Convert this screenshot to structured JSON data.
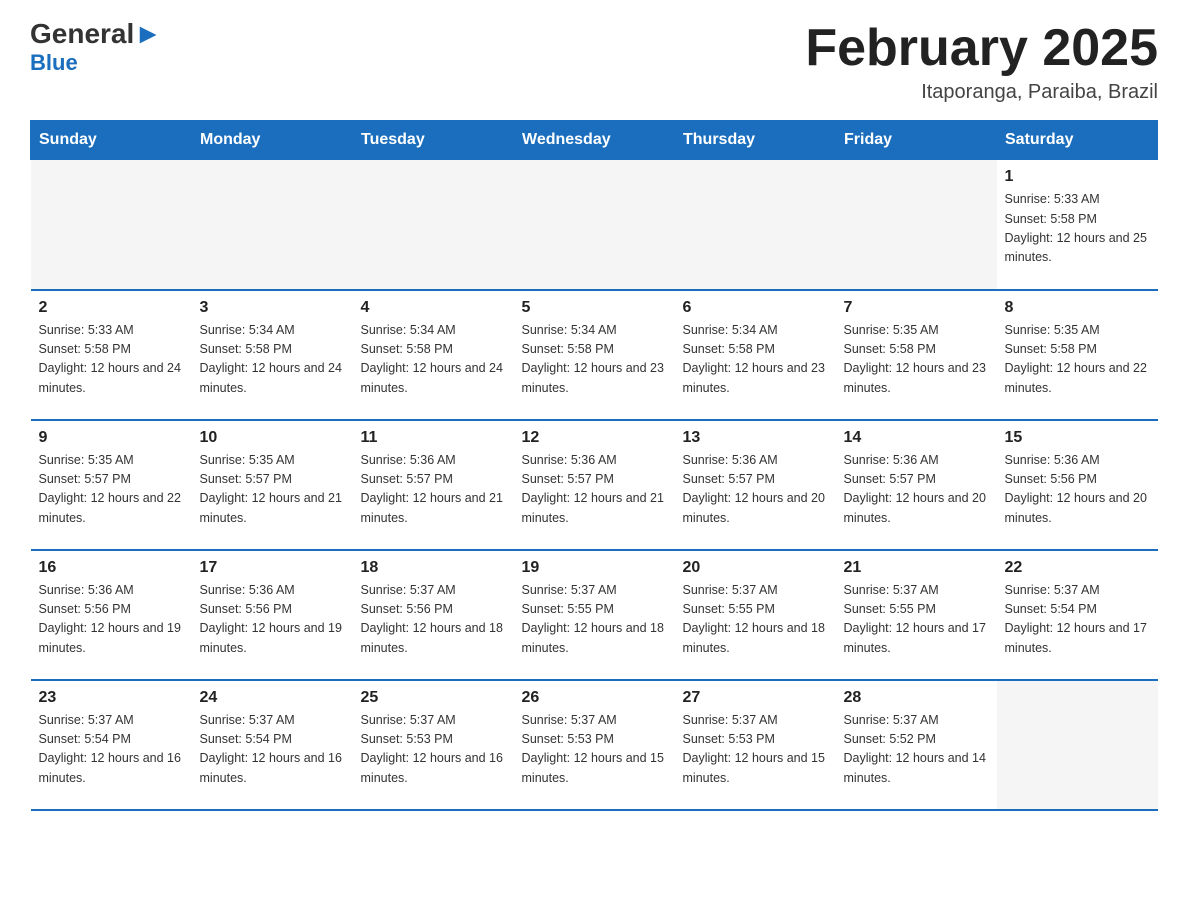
{
  "logo": {
    "text_general": "General",
    "text_arrow": "▶",
    "text_blue": "Blue"
  },
  "title": "February 2025",
  "location": "Itaporanga, Paraiba, Brazil",
  "weekdays": [
    "Sunday",
    "Monday",
    "Tuesday",
    "Wednesday",
    "Thursday",
    "Friday",
    "Saturday"
  ],
  "weeks": [
    [
      {
        "day": "",
        "info": ""
      },
      {
        "day": "",
        "info": ""
      },
      {
        "day": "",
        "info": ""
      },
      {
        "day": "",
        "info": ""
      },
      {
        "day": "",
        "info": ""
      },
      {
        "day": "",
        "info": ""
      },
      {
        "day": "1",
        "info": "Sunrise: 5:33 AM\nSunset: 5:58 PM\nDaylight: 12 hours and 25 minutes."
      }
    ],
    [
      {
        "day": "2",
        "info": "Sunrise: 5:33 AM\nSunset: 5:58 PM\nDaylight: 12 hours and 24 minutes."
      },
      {
        "day": "3",
        "info": "Sunrise: 5:34 AM\nSunset: 5:58 PM\nDaylight: 12 hours and 24 minutes."
      },
      {
        "day": "4",
        "info": "Sunrise: 5:34 AM\nSunset: 5:58 PM\nDaylight: 12 hours and 24 minutes."
      },
      {
        "day": "5",
        "info": "Sunrise: 5:34 AM\nSunset: 5:58 PM\nDaylight: 12 hours and 23 minutes."
      },
      {
        "day": "6",
        "info": "Sunrise: 5:34 AM\nSunset: 5:58 PM\nDaylight: 12 hours and 23 minutes."
      },
      {
        "day": "7",
        "info": "Sunrise: 5:35 AM\nSunset: 5:58 PM\nDaylight: 12 hours and 23 minutes."
      },
      {
        "day": "8",
        "info": "Sunrise: 5:35 AM\nSunset: 5:58 PM\nDaylight: 12 hours and 22 minutes."
      }
    ],
    [
      {
        "day": "9",
        "info": "Sunrise: 5:35 AM\nSunset: 5:57 PM\nDaylight: 12 hours and 22 minutes."
      },
      {
        "day": "10",
        "info": "Sunrise: 5:35 AM\nSunset: 5:57 PM\nDaylight: 12 hours and 21 minutes."
      },
      {
        "day": "11",
        "info": "Sunrise: 5:36 AM\nSunset: 5:57 PM\nDaylight: 12 hours and 21 minutes."
      },
      {
        "day": "12",
        "info": "Sunrise: 5:36 AM\nSunset: 5:57 PM\nDaylight: 12 hours and 21 minutes."
      },
      {
        "day": "13",
        "info": "Sunrise: 5:36 AM\nSunset: 5:57 PM\nDaylight: 12 hours and 20 minutes."
      },
      {
        "day": "14",
        "info": "Sunrise: 5:36 AM\nSunset: 5:57 PM\nDaylight: 12 hours and 20 minutes."
      },
      {
        "day": "15",
        "info": "Sunrise: 5:36 AM\nSunset: 5:56 PM\nDaylight: 12 hours and 20 minutes."
      }
    ],
    [
      {
        "day": "16",
        "info": "Sunrise: 5:36 AM\nSunset: 5:56 PM\nDaylight: 12 hours and 19 minutes."
      },
      {
        "day": "17",
        "info": "Sunrise: 5:36 AM\nSunset: 5:56 PM\nDaylight: 12 hours and 19 minutes."
      },
      {
        "day": "18",
        "info": "Sunrise: 5:37 AM\nSunset: 5:56 PM\nDaylight: 12 hours and 18 minutes."
      },
      {
        "day": "19",
        "info": "Sunrise: 5:37 AM\nSunset: 5:55 PM\nDaylight: 12 hours and 18 minutes."
      },
      {
        "day": "20",
        "info": "Sunrise: 5:37 AM\nSunset: 5:55 PM\nDaylight: 12 hours and 18 minutes."
      },
      {
        "day": "21",
        "info": "Sunrise: 5:37 AM\nSunset: 5:55 PM\nDaylight: 12 hours and 17 minutes."
      },
      {
        "day": "22",
        "info": "Sunrise: 5:37 AM\nSunset: 5:54 PM\nDaylight: 12 hours and 17 minutes."
      }
    ],
    [
      {
        "day": "23",
        "info": "Sunrise: 5:37 AM\nSunset: 5:54 PM\nDaylight: 12 hours and 16 minutes."
      },
      {
        "day": "24",
        "info": "Sunrise: 5:37 AM\nSunset: 5:54 PM\nDaylight: 12 hours and 16 minutes."
      },
      {
        "day": "25",
        "info": "Sunrise: 5:37 AM\nSunset: 5:53 PM\nDaylight: 12 hours and 16 minutes."
      },
      {
        "day": "26",
        "info": "Sunrise: 5:37 AM\nSunset: 5:53 PM\nDaylight: 12 hours and 15 minutes."
      },
      {
        "day": "27",
        "info": "Sunrise: 5:37 AM\nSunset: 5:53 PM\nDaylight: 12 hours and 15 minutes."
      },
      {
        "day": "28",
        "info": "Sunrise: 5:37 AM\nSunset: 5:52 PM\nDaylight: 12 hours and 14 minutes."
      },
      {
        "day": "",
        "info": ""
      }
    ]
  ]
}
